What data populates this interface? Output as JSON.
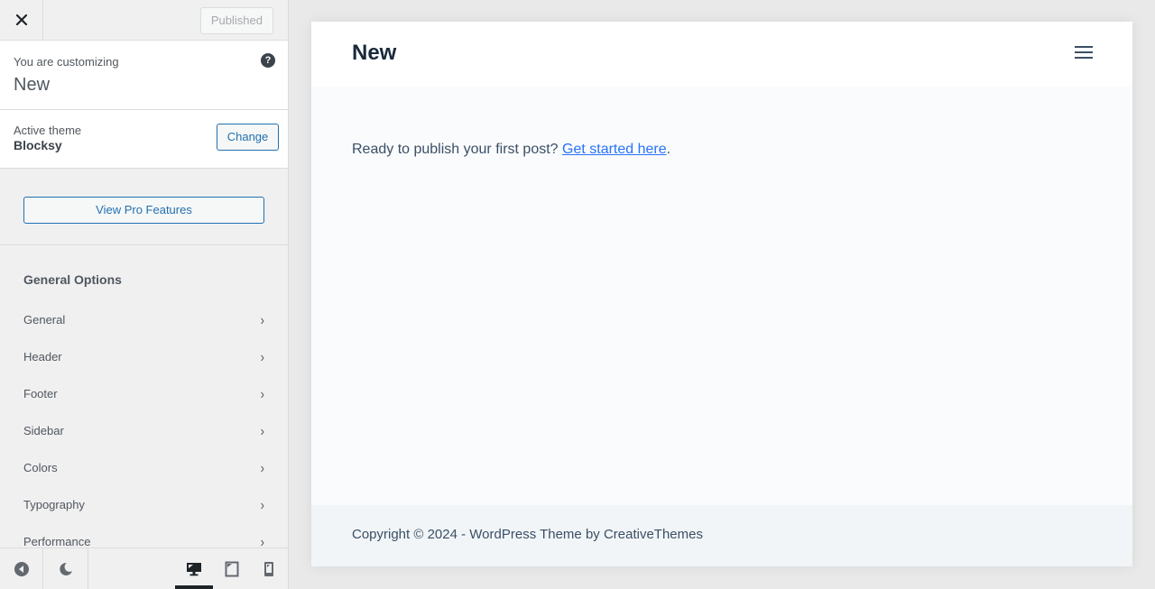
{
  "topbar": {
    "close_label": "Close",
    "published_label": "Published"
  },
  "info": {
    "customizing_label": "You are customizing",
    "site_name": "New",
    "help_glyph": "?"
  },
  "theme": {
    "label": "Active theme",
    "name": "Blocksy",
    "change_label": "Change"
  },
  "pro": {
    "label": "View Pro Features"
  },
  "options": {
    "title": "General Options",
    "items": [
      {
        "label": "General"
      },
      {
        "label": "Header"
      },
      {
        "label": "Footer"
      },
      {
        "label": "Sidebar"
      },
      {
        "label": "Colors"
      },
      {
        "label": "Typography"
      },
      {
        "label": "Performance"
      }
    ],
    "chevron_glyph": "›"
  },
  "footer_bar": {
    "active_device": "desktop",
    "devices": [
      "desktop",
      "tablet",
      "mobile"
    ]
  },
  "preview": {
    "site_title": "New",
    "intro_text": "Ready to publish your first post? ",
    "link_text": "Get started here",
    "trailing": ".",
    "copyright": "Copyright © 2024 - WordPress Theme by CreativeThemes"
  },
  "colors": {
    "accent": "#2271b1",
    "link": "#2872fa",
    "heading": "#192a3d",
    "text": "#3a4f66"
  }
}
